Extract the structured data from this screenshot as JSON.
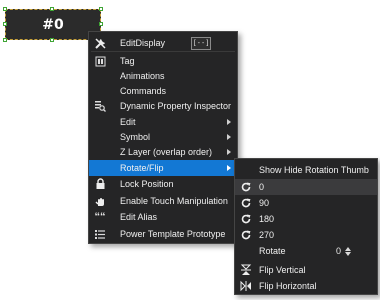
{
  "canvas_widget": {
    "text": "#0"
  },
  "context_menu": {
    "items": [
      {
        "label": "EditDisplay",
        "icon": "tools-icon",
        "button_label": "[--]"
      },
      {
        "label": "Tag",
        "icon": "tag-icon"
      },
      {
        "label": "Animations"
      },
      {
        "label": "Commands"
      },
      {
        "label": "Dynamic Property Inspector",
        "icon": "property-inspector-icon"
      },
      {
        "label": "Edit",
        "has_submenu": true
      },
      {
        "label": "Symbol",
        "has_submenu": true
      },
      {
        "label": "Z Layer (overlap order)",
        "has_submenu": true
      },
      {
        "label": "Rotate/Flip",
        "has_submenu": true,
        "highlighted": true
      },
      {
        "label": "Lock Position",
        "icon": "lock-icon"
      },
      {
        "label": "Enable Touch Manipulation",
        "icon": "touch-icon"
      },
      {
        "label": "Edit Alias",
        "icon": "quote-icon"
      },
      {
        "label": "Power Template Prototype",
        "icon": "list-icon"
      }
    ]
  },
  "rotate_submenu": {
    "show_hide_label": "Show Hide Rotation Thumb",
    "rotate_options": [
      "0",
      "90",
      "180",
      "270"
    ],
    "rotate_label": "Rotate",
    "rotate_value": "0",
    "flip_vertical_label": "Flip Vertical",
    "flip_horizontal_label": "Flip Horizontal"
  },
  "colors": {
    "menu_background": "#252526",
    "highlight": "#1378d4",
    "selection_border": "#c9a23b",
    "handle_border": "#3fa535"
  }
}
